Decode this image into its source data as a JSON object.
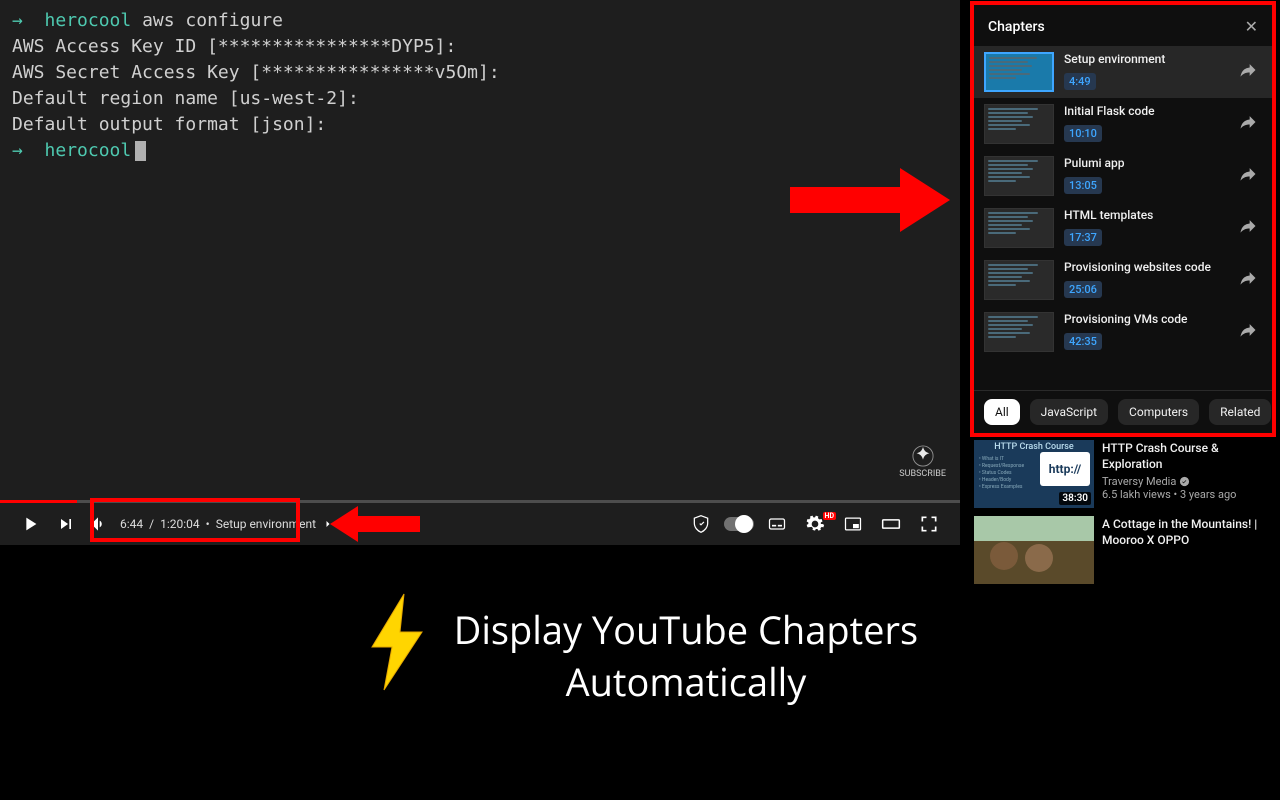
{
  "terminal": {
    "prompt_arrow": "→",
    "user": "herocool",
    "cmd": "aws configure",
    "line1": "AWS Access Key ID [****************DYP5]:",
    "line2": "AWS Secret Access Key [****************v5Om]:",
    "line3": "Default region name [us-west-2]:",
    "line4": "Default output format [json]:"
  },
  "watermark": "SUBSCRIBE",
  "player": {
    "current_time": "6:44",
    "total_time": "1:20:04",
    "separator": "/",
    "dot": "•",
    "current_chapter": "Setup environment"
  },
  "chapters": {
    "header": "Chapters",
    "items": [
      {
        "title": "Setup environment",
        "time": "4:49",
        "active": true
      },
      {
        "title": "Initial Flask code",
        "time": "10:10",
        "active": false
      },
      {
        "title": "Pulumi app",
        "time": "13:05",
        "active": false
      },
      {
        "title": "HTML templates",
        "time": "17:37",
        "active": false
      },
      {
        "title": "Provisioning websites code",
        "time": "25:06",
        "active": false
      },
      {
        "title": "Provisioning VMs code",
        "time": "42:35",
        "active": false
      }
    ]
  },
  "chips": [
    "All",
    "JavaScript",
    "Computers",
    "Related"
  ],
  "suggested": [
    {
      "title": "HTTP Crash Course & Exploration",
      "channel": "Traversy Media",
      "meta": "6.5 lakh views • 3 years ago",
      "duration": "38:30",
      "header": "HTTP Crash Course",
      "httplabel": "http://"
    },
    {
      "title": "A Cottage in the Mountains! | Mooroo X OPPO",
      "channel": "",
      "meta": "",
      "duration": ""
    }
  ],
  "promo": {
    "line1": "Display YouTube Chapters",
    "line2": "Automatically"
  },
  "thumb_bullets": [
    "• What is IT",
    "• Request/Response",
    "• Status Codes",
    "• Header/Body",
    "• Express Examples"
  ]
}
